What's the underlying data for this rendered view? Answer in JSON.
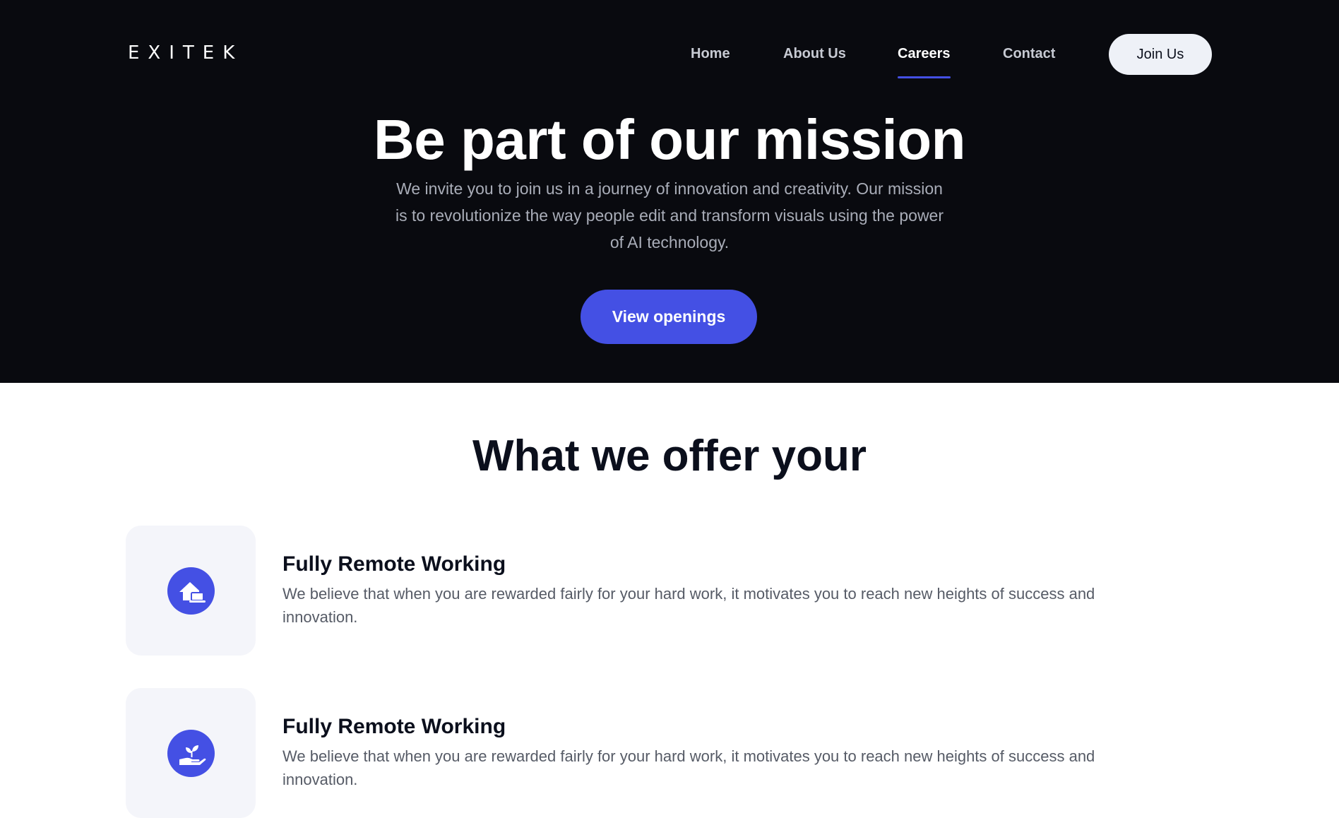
{
  "brand": {
    "logo": "EXITEK",
    "accent": "#4450e4"
  },
  "nav": {
    "items": [
      {
        "label": "Home"
      },
      {
        "label": "About Us"
      },
      {
        "label": "Careers",
        "active": true
      },
      {
        "label": "Contact"
      }
    ],
    "join_label": "Join Us"
  },
  "hero": {
    "title": "Be part of our mission",
    "text": "We invite you to join us in a journey of innovation and creativity. Our mission is to revolutionize the way people edit and transform visuals using the power of AI technology.",
    "cta_label": "View openings"
  },
  "offer": {
    "title": "What we offer your",
    "items": [
      {
        "icon": "remote-house-icon",
        "heading": "Fully Remote Working",
        "text": "We believe that when you are rewarded fairly for your hard work, it motivates you to reach new heights of success and innovation."
      },
      {
        "icon": "growth-hand-icon",
        "heading": "Fully Remote Working",
        "text": "We believe that when you are rewarded fairly for your hard work, it motivates you to reach new heights of success and innovation."
      }
    ]
  }
}
